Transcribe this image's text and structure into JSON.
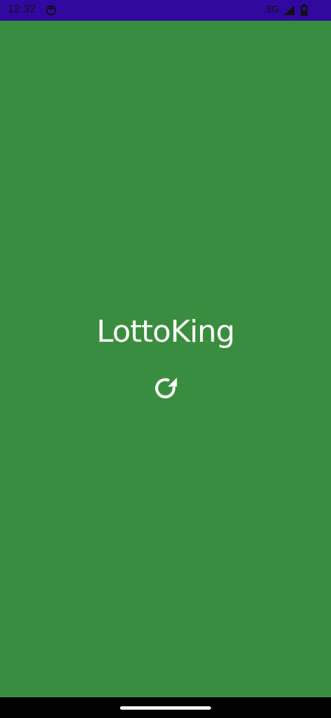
{
  "status_bar": {
    "time": "12:32",
    "network_type": "3G",
    "icons": [
      "notification-icon",
      "signal-icon",
      "battery-icon"
    ],
    "background_color": "#3209a0"
  },
  "main": {
    "app_title": "LottoKing",
    "loading_icon": "refresh-icon",
    "background_color": "#3a8d3e"
  },
  "nav_bar": {
    "handle": "home-handle"
  }
}
